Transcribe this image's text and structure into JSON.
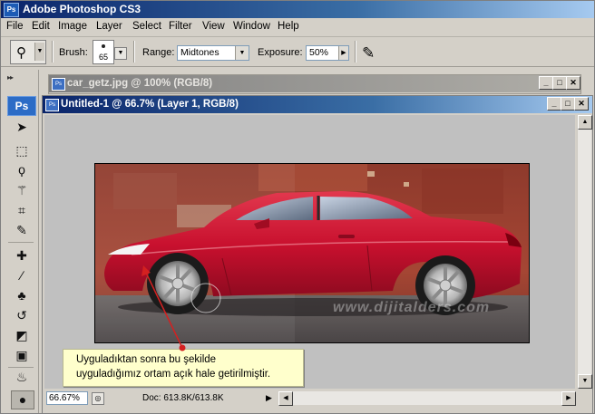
{
  "app": {
    "title": "Adobe Photoshop CS3",
    "badge": "Ps"
  },
  "menu": [
    "File",
    "Edit",
    "Image",
    "Layer",
    "Select",
    "Filter",
    "View",
    "Window",
    "Help"
  ],
  "options": {
    "brush_label": "Brush:",
    "brush_size": "65",
    "range_label": "Range:",
    "range_value": "Midtones",
    "exposure_label": "Exposure:",
    "exposure_value": "50%",
    "tool_icon": "dodge-tool-icon",
    "airbrush_icon": "airbrush-icon"
  },
  "toolbox": {
    "logo": "Ps",
    "tools": [
      {
        "name": "move-tool-icon",
        "glyph": "➤"
      },
      {
        "name": "marquee-tool-icon",
        "glyph": "⬚"
      },
      {
        "name": "lasso-tool-icon",
        "glyph": "ϙ"
      },
      {
        "name": "magic-wand-tool-icon",
        "glyph": "⚚"
      },
      {
        "name": "crop-tool-icon",
        "glyph": "⌗"
      },
      {
        "name": "eyedropper-tool-icon",
        "glyph": "✎"
      },
      {
        "name": "healing-brush-tool-icon",
        "glyph": "✚"
      },
      {
        "name": "brush-tool-icon",
        "glyph": "∕"
      },
      {
        "name": "clone-stamp-tool-icon",
        "glyph": "♣"
      },
      {
        "name": "history-brush-tool-icon",
        "glyph": "↺"
      },
      {
        "name": "eraser-tool-icon",
        "glyph": "◩"
      },
      {
        "name": "gradient-tool-icon",
        "glyph": "▣"
      },
      {
        "name": "blur-tool-icon",
        "glyph": "♨"
      },
      {
        "name": "dodge-tool-icon",
        "glyph": "●"
      }
    ]
  },
  "documents": {
    "background": {
      "title": "car_getz.jpg @ 100% (RGB/8)"
    },
    "front": {
      "title": "Untitled-1 @ 66.7% (Layer 1, RGB/8)",
      "zoom": "66.67%",
      "doc_info": "Doc: 613.8K/613.8K"
    }
  },
  "watermark": "www.dijitalders.com",
  "callout": {
    "line1": "Uyguladıktan sonra bu şekilde",
    "line2": "uyguladığımız ortam açık hale getirilmiştir."
  },
  "colors": {
    "accent_blue": "#0a246a",
    "chrome": "#d4d0c8",
    "car_red": "#c8102e",
    "callout_bg": "#ffffcc",
    "pointer_red": "#d42020"
  }
}
